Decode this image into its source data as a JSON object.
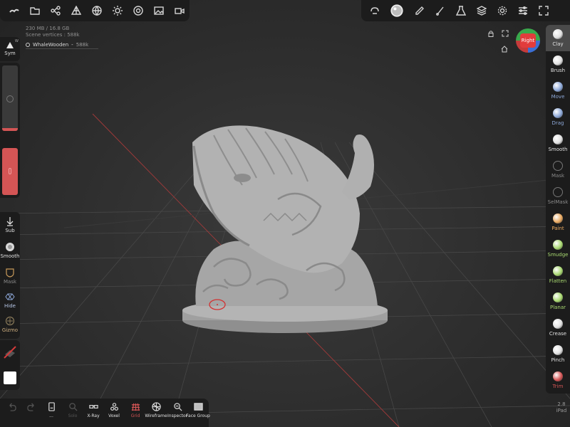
{
  "scene_info": {
    "memory": "230 MB / 16.8 GB",
    "vertices_label": "Scene vertices : 588k"
  },
  "mesh": {
    "name": "WhaleWooden",
    "vertices": "588k"
  },
  "left_panel": {
    "symmetry_label": "Sym",
    "symmetry_axis": "W",
    "radius_level": 0.04,
    "intensity_level": 1.0,
    "tools": [
      {
        "label": "Sub",
        "icon": "arrow-down-icon"
      },
      {
        "label": "Smooth",
        "icon": "smooth-icon"
      },
      {
        "label": "Mask",
        "icon": "mask-icon"
      },
      {
        "label": "Hide",
        "icon": "hide-icon"
      },
      {
        "label": "Gizmo",
        "icon": "gizmo-icon"
      }
    ],
    "color": "#ffffff"
  },
  "view_cube": {
    "face_label": "Right"
  },
  "right_tools": [
    {
      "label": "Clay",
      "color": "#e0e0e0"
    },
    {
      "label": "Brush",
      "color": "#e0e0e0"
    },
    {
      "label": "Move",
      "color": "#8da8d8"
    },
    {
      "label": "Drag",
      "color": "#8da8d8"
    },
    {
      "label": "Smooth",
      "color": "#e0e0e0"
    },
    {
      "label": "Mask",
      "color": "#8a8a8a"
    },
    {
      "label": "SelMask",
      "color": "#8a8a8a"
    },
    {
      "label": "Paint",
      "color": "#e8a860"
    },
    {
      "label": "Smudge",
      "color": "#a8d870"
    },
    {
      "label": "Flatten",
      "color": "#a8d870"
    },
    {
      "label": "Planar",
      "color": "#a8d870"
    },
    {
      "label": "Crease",
      "color": "#e0e0e0"
    },
    {
      "label": "Pinch",
      "color": "#e0e0e0"
    },
    {
      "label": "Trim",
      "color": "#d45555"
    }
  ],
  "version": {
    "number": "2.8",
    "device": "iPad"
  },
  "bottom_bar": [
    {
      "label": "",
      "icon": "undo-icon",
      "enabled": false
    },
    {
      "label": "",
      "icon": "redo-icon",
      "enabled": false
    },
    {
      "label": "...",
      "icon": "phone-icon",
      "enabled": true
    },
    {
      "label": "Solo",
      "icon": "search-icon",
      "enabled": false
    },
    {
      "label": "X-Ray",
      "icon": "glasses-icon",
      "enabled": true
    },
    {
      "label": "Voxel",
      "icon": "voxel-icon",
      "enabled": true
    },
    {
      "label": "Grid",
      "icon": "grid-icon",
      "enabled": true,
      "active": true
    },
    {
      "label": "Wireframe",
      "icon": "wireframe-icon",
      "enabled": true
    },
    {
      "label": "Inspector",
      "icon": "inspector-icon",
      "enabled": true
    },
    {
      "label": "Face Group",
      "icon": "facegroup-icon",
      "enabled": true
    }
  ],
  "top_left_icons": [
    "logo-icon",
    "folder-icon",
    "scene-icon",
    "topology-icon",
    "globe-icon",
    "sun-icon",
    "camera-lens-icon",
    "image-icon",
    "video-icon"
  ],
  "top_right_icons": [
    "transform-icon",
    "material-icon",
    "pen-icon",
    "stroke-icon",
    "flask-icon",
    "layers-icon",
    "gear-icon",
    "sliders-icon",
    "expand-icon"
  ]
}
